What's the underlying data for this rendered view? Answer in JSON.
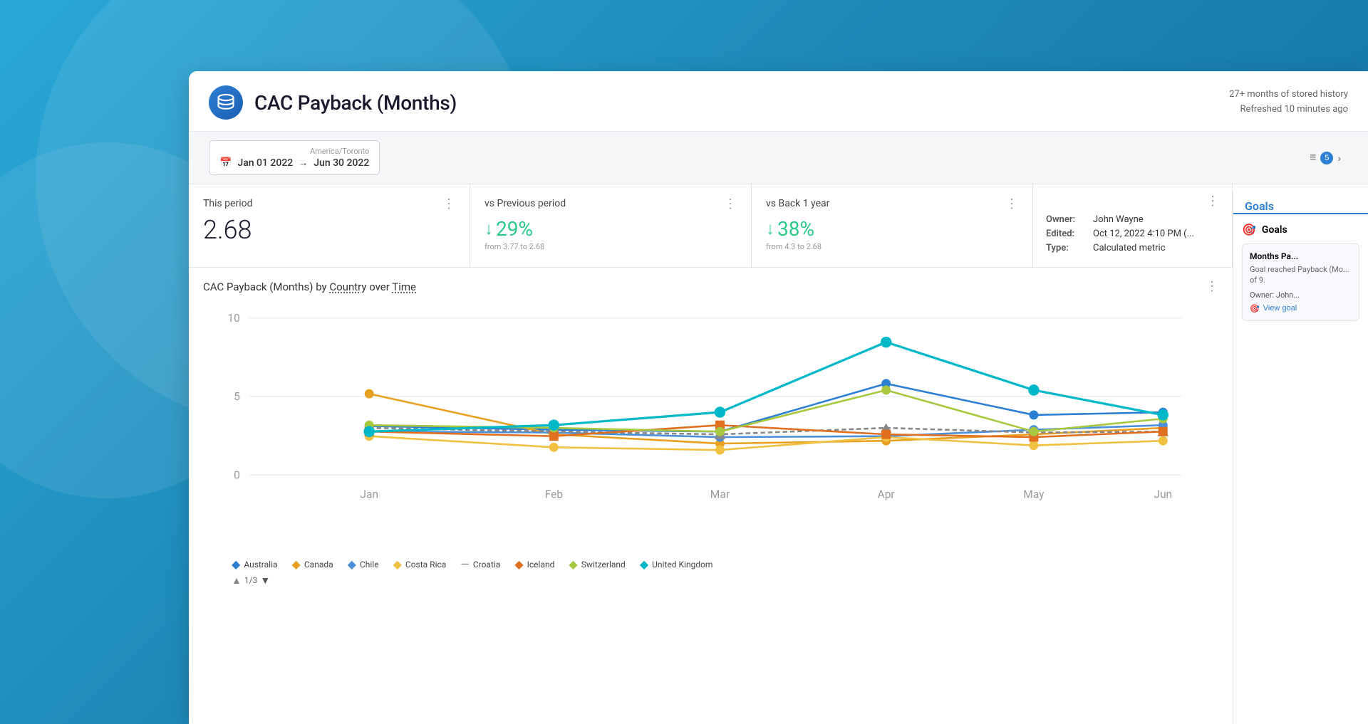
{
  "background": {
    "gradient_start": "#29a8d8",
    "gradient_end": "#0f6a9a"
  },
  "header": {
    "title": "CAC Payback (Months)",
    "history_text": "27+ months of stored history",
    "refreshed_text": "Refreshed 10 minutes ago",
    "db_icon": "database-icon"
  },
  "toolbar": {
    "timezone": "America/Toronto",
    "date_start": "Jan 01 2022",
    "date_end": "Jun 30 2022",
    "filter_label": "",
    "filter_count": "5",
    "goals_tab_label": "Goals"
  },
  "metrics": [
    {
      "title": "This period",
      "value": "2.68",
      "change": null,
      "from": null
    },
    {
      "title": "vs Previous period",
      "value": "↓29%",
      "change_direction": "down",
      "change_pct": "29%",
      "from_text": "from 3.77 to 2.68"
    },
    {
      "title": "vs Back 1 year",
      "value": "↓38%",
      "change_direction": "down",
      "change_pct": "38%",
      "from_text": "from 4.3 to 2.68"
    }
  ],
  "info_card": {
    "owner_label": "Owner:",
    "owner_value": "John Wayne",
    "edited_label": "Edited:",
    "edited_value": "Oct 12, 2022 4:10 PM (...",
    "type_label": "Type:",
    "type_value": "Calculated metric"
  },
  "chart": {
    "title_start": "CAC Payback (Months)",
    "title_by": "by",
    "title_dimension": "Country",
    "title_over": "over",
    "title_time": "Time",
    "y_labels": [
      "0",
      "5",
      "10"
    ],
    "x_labels": [
      "Jan",
      "Feb",
      "Mar",
      "Apr",
      "May",
      "Jun"
    ],
    "series": [
      {
        "name": "Australia",
        "color": "#2d7fd3",
        "marker": "dot",
        "values": [
          3.1,
          2.9,
          2.8,
          5.8,
          3.8,
          4.0
        ]
      },
      {
        "name": "Canada",
        "color": "#e8a020",
        "marker": "dot",
        "values": [
          5.2,
          2.6,
          2.0,
          2.2,
          2.6,
          3.0
        ]
      },
      {
        "name": "Chile",
        "color": "#4a90d9",
        "marker": "dot",
        "values": [
          2.8,
          2.7,
          2.4,
          2.5,
          2.9,
          3.2
        ]
      },
      {
        "name": "Costa Rica",
        "color": "#f0c040",
        "marker": "dot",
        "values": [
          2.5,
          1.8,
          1.6,
          2.4,
          1.9,
          2.2
        ]
      },
      {
        "name": "Croatia",
        "color": "#666",
        "marker": "dash",
        "values": [
          3.0,
          2.8,
          2.6,
          3.0,
          2.7,
          2.8
        ]
      },
      {
        "name": "Iceland",
        "color": "#e07020",
        "marker": "dot",
        "values": [
          2.8,
          2.5,
          3.2,
          2.6,
          2.4,
          2.8
        ]
      },
      {
        "name": "Switzerland",
        "color": "#a8c840",
        "marker": "dot",
        "values": [
          3.2,
          3.0,
          2.8,
          5.4,
          2.8,
          3.6
        ]
      },
      {
        "name": "United Kingdom",
        "color": "#00b8c8",
        "marker": "dot",
        "values": [
          2.8,
          3.2,
          4.0,
          8.5,
          5.4,
          3.8
        ]
      }
    ]
  },
  "legend": {
    "page_current": "1/3",
    "items": [
      {
        "name": "Australia",
        "color": "#2d7fd3"
      },
      {
        "name": "Canada",
        "color": "#e8a020"
      },
      {
        "name": "Chile",
        "color": "#4a90d9"
      },
      {
        "name": "Costa Rica",
        "color": "#f0c040"
      },
      {
        "name": "Croatia",
        "color": "#888"
      },
      {
        "name": "Iceland",
        "color": "#e07020"
      },
      {
        "name": "Switzerland",
        "color": "#a8c840"
      },
      {
        "name": "United Kingdom",
        "color": "#00b8c8"
      }
    ]
  },
  "goals_panel": {
    "section_title": "Goals",
    "goal_title": "Months Pa...",
    "goal_desc": "Goal reached Payback (Mo... of 9.",
    "owner_label": "Owner:",
    "owner_value": "John...",
    "view_goal_label": "View goal"
  }
}
